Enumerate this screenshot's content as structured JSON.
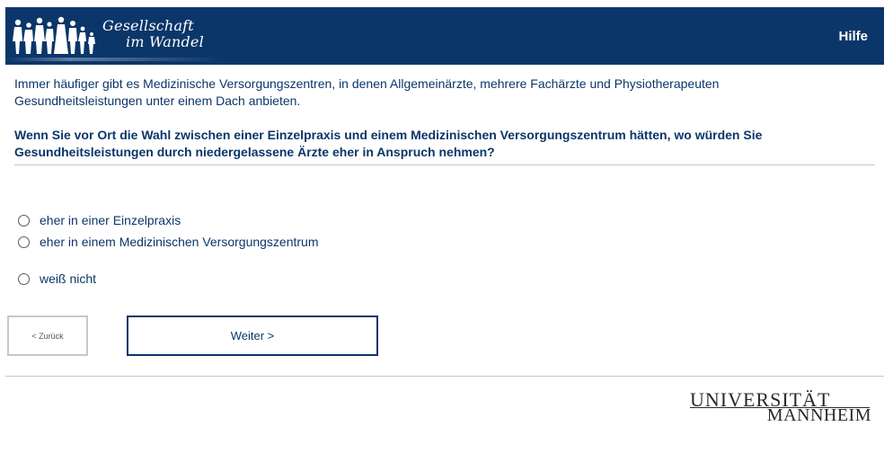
{
  "header": {
    "logo_line1": "Gesellschaft",
    "logo_line2": "im Wandel",
    "help_label": "Hilfe",
    "background_color": "#0b3669"
  },
  "intro_text": "Immer häufiger gibt es Medizinische Versorgungszentren, in denen Allgemeinärzte, mehrere Fachärzte und Physiotherapeuten Gesundheitsleistungen unter einem Dach anbieten.",
  "question_text": "Wenn Sie vor Ort die Wahl zwischen einer Einzelpraxis und einem Medizinischen Versorgungszentrum hätten, wo würden Sie Gesundheitsleistungen durch niedergelassene Ärzte eher in Anspruch nehmen?",
  "options": [
    {
      "label": "eher in einer Einzelpraxis",
      "selected": false
    },
    {
      "label": "eher in einem Medizinischen Versorgungszentrum",
      "selected": false
    },
    {
      "label": "weiß nicht",
      "selected": false
    }
  ],
  "navigation": {
    "back_label": "< Zurück",
    "next_label": "Weiter >"
  },
  "footer": {
    "logo_top": "UNIVERSITÄT",
    "logo_bottom": "MANNHEIM"
  }
}
